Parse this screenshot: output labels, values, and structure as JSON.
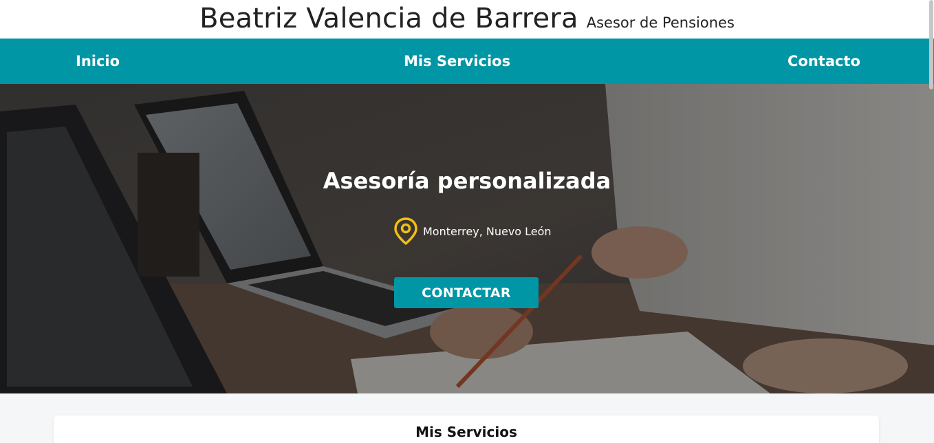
{
  "header": {
    "name": "Beatriz Valencia de Barrera",
    "role": "Asesor de Pensiones"
  },
  "nav": {
    "items": [
      {
        "label": "Inicio"
      },
      {
        "label": "Mis Servicios"
      },
      {
        "label": "Contacto"
      }
    ]
  },
  "hero": {
    "title": "Asesoría personalizada",
    "location": "Monterrey, Nuevo León",
    "location_icon": "map-pin-icon",
    "cta_label": "CONTACTAR"
  },
  "services": {
    "title": "Mis Servicios"
  },
  "colors": {
    "accent": "#0096a6",
    "pin": "#f2c012",
    "header_bg": "#ffffff"
  }
}
